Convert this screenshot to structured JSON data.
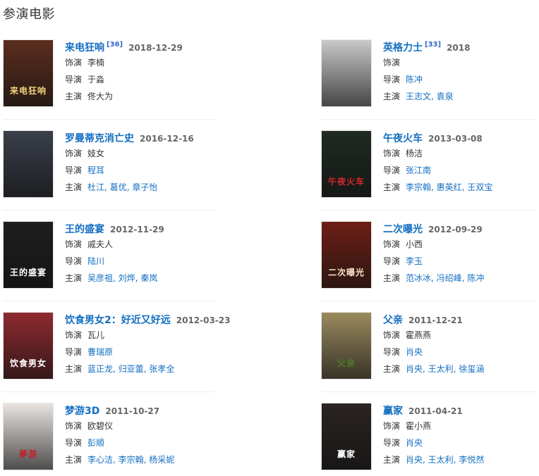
{
  "section": {
    "title": "参演电影"
  },
  "labels": {
    "role": "饰演",
    "director": "导演",
    "starring": "主演"
  },
  "movies": [
    {
      "title": "来电狂响",
      "ref": "[36]",
      "date": "2018-12-29",
      "role": "李楠",
      "director": [
        "于淼"
      ],
      "director_linked": false,
      "stars": [
        "佟大为"
      ],
      "stars_linked": false,
      "poster_text": "来电狂响"
    },
    {
      "title": "英格力士",
      "ref": "[33]",
      "date": "2018",
      "role": "",
      "director": [
        "陈冲"
      ],
      "director_linked": true,
      "stars": [
        "王志文",
        "袁泉"
      ],
      "stars_linked": true,
      "poster_text": ""
    },
    {
      "title": "罗曼蒂克消亡史",
      "ref": "",
      "date": "2016-12-16",
      "role": "妓女",
      "director": [
        "程耳"
      ],
      "director_linked": true,
      "stars": [
        "杜江",
        "葛优",
        "章子怡"
      ],
      "stars_linked": true,
      "poster_text": ""
    },
    {
      "title": "午夜火车",
      "ref": "",
      "date": "2013-03-08",
      "role": "杨洁",
      "director": [
        "张江南"
      ],
      "director_linked": true,
      "stars": [
        "李宗翰",
        "惠英红",
        "王双宝"
      ],
      "stars_linked": true,
      "poster_text": "午夜火车"
    },
    {
      "title": "王的盛宴",
      "ref": "",
      "date": "2012-11-29",
      "role": "戚夫人",
      "director": [
        "陆川"
      ],
      "director_linked": true,
      "stars": [
        "吴彦祖",
        "刘烨",
        "秦岚"
      ],
      "stars_linked": true,
      "poster_text": "王的盛宴"
    },
    {
      "title": "二次曝光",
      "ref": "",
      "date": "2012-09-29",
      "role": "小西",
      "director": [
        "李玉"
      ],
      "director_linked": true,
      "stars": [
        "范冰冰",
        "冯绍峰",
        "陈冲"
      ],
      "stars_linked": true,
      "poster_text": "二次曝光"
    },
    {
      "title": "饮食男女2：好近又好远",
      "ref": "",
      "date": "2012-03-23",
      "role": "瓦儿",
      "director": [
        "曹瑞原"
      ],
      "director_linked": true,
      "stars": [
        "蓝正龙",
        "归亚蕾",
        "张孝全"
      ],
      "stars_linked": true,
      "poster_text": "饮食男女"
    },
    {
      "title": "父亲",
      "ref": "",
      "date": "2011-12-21",
      "role": "霍燕燕",
      "director": [
        "肖央"
      ],
      "director_linked": true,
      "stars": [
        "肖央",
        "王太利",
        "徐玺涵"
      ],
      "stars_linked": true,
      "poster_text": "父亲"
    },
    {
      "title": "梦游3D",
      "ref": "",
      "date": "2011-10-27",
      "role": "欧碧仪",
      "director": [
        "彭顺"
      ],
      "director_linked": true,
      "stars": [
        "李心洁",
        "李宗翰",
        "杨采妮"
      ],
      "stars_linked": true,
      "poster_text": "夢游"
    },
    {
      "title": "赢家",
      "ref": "",
      "date": "2011-04-21",
      "role": "霍小燕",
      "director": [
        "肖央"
      ],
      "director_linked": true,
      "stars": [
        "肖央",
        "王太利",
        "李悦然"
      ],
      "stars_linked": true,
      "poster_text": "赢家"
    }
  ],
  "poster_colors": [
    {
      "bg": "#5a2e1e",
      "fg": "#f3d27a"
    },
    {
      "bg": "#c9c9c9",
      "fg": "#444444"
    },
    {
      "bg": "#3a3f4a",
      "fg": "#ffffff"
    },
    {
      "bg": "#1f2a22",
      "fg": "#d8262c"
    },
    {
      "bg": "#1e1e1e",
      "fg": "#ffffff"
    },
    {
      "bg": "#6e1f16",
      "fg": "#f7e3c4"
    },
    {
      "bg": "#8e2a2f",
      "fg": "#ffffff"
    },
    {
      "bg": "#9a8a5e",
      "fg": "#4a7a2a"
    },
    {
      "bg": "#e9e4e0",
      "fg": "#c0202a"
    },
    {
      "bg": "#2a2422",
      "fg": "#ffffff"
    }
  ]
}
